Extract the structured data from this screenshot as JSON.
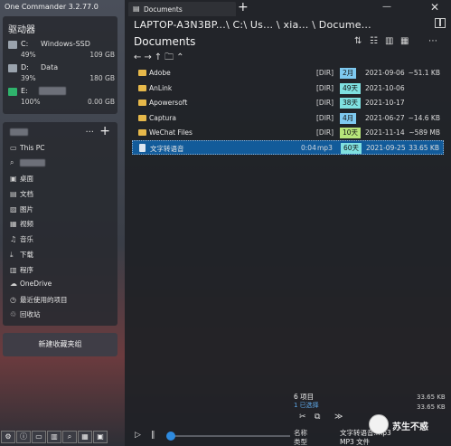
{
  "app": {
    "title": "One Commander 3.2.77.0"
  },
  "drives": {
    "title": "驱动器",
    "items": [
      {
        "letter": "C:",
        "name": "Windows-SSD",
        "percent": "49%",
        "size": "109 GB",
        "color": "#9aa3ad"
      },
      {
        "letter": "D:",
        "name": "Data",
        "percent": "39%",
        "size": "180 GB",
        "color": "#9aa3ad"
      },
      {
        "letter": "E:",
        "name": "",
        "percent": "100%",
        "size": "0.00 GB",
        "color": "#2fb36c"
      }
    ]
  },
  "favorites": {
    "more_label": "···",
    "add_label": "+",
    "items": [
      {
        "icon": "computer-icon",
        "glyph": "▭",
        "label": "This PC"
      },
      {
        "icon": "search-icon",
        "glyph": "⌕",
        "label": ""
      },
      {
        "icon": "desktop-icon",
        "glyph": "▣",
        "label": "桌面"
      },
      {
        "icon": "documents-icon",
        "glyph": "▤",
        "label": "文档"
      },
      {
        "icon": "pictures-icon",
        "glyph": "▨",
        "label": "图片"
      },
      {
        "icon": "videos-icon",
        "glyph": "▦",
        "label": "视频"
      },
      {
        "icon": "music-icon",
        "glyph": "♫",
        "label": "音乐"
      },
      {
        "icon": "downloads-icon",
        "glyph": "⤓",
        "label": "下载"
      },
      {
        "icon": "programs-icon",
        "glyph": "▥",
        "label": "程序"
      },
      {
        "icon": "onedrive-icon",
        "glyph": "☁",
        "label": "OneDrive"
      },
      {
        "icon": "recent-icon",
        "glyph": "◷",
        "label": "最近使用的项目"
      },
      {
        "icon": "recycle-bin-icon",
        "glyph": "♲",
        "label": "回收站"
      }
    ]
  },
  "new_group_label": "新建收藏夹组",
  "tabs": [
    {
      "label": "Documents"
    }
  ],
  "add_tab_label": "+",
  "breadcrumb": "LAPTOP-A3N3BP...\\ C:\\ Us...  \\ xia...  \\ Docume...",
  "pane_title": "Documents",
  "toolbar_glyphs": {
    "sort": "⇅",
    "details": "☷",
    "columns": "▥",
    "tiles": "▦",
    "more": "⋯"
  },
  "nav_glyphs": "←→↑🗀⌃",
  "files": [
    {
      "name": "Adobe",
      "kind": "folder",
      "duration": "",
      "type": "[DIR]",
      "age": "2月",
      "age_color": "#7ec9f0",
      "date": "2021-09-06",
      "size": "~51.1 KB"
    },
    {
      "name": "AnLink",
      "kind": "folder",
      "duration": "",
      "type": "[DIR]",
      "age": "49天",
      "age_color": "#7fe0e0",
      "date": "2021-10-06",
      "size": ""
    },
    {
      "name": "Apowersoft",
      "kind": "folder",
      "duration": "",
      "type": "[DIR]",
      "age": "38天",
      "age_color": "#7fe0e0",
      "date": "2021-10-17",
      "size": ""
    },
    {
      "name": "Captura",
      "kind": "folder",
      "duration": "",
      "type": "[DIR]",
      "age": "4月",
      "age_color": "#7ec9f0",
      "date": "2021-06-27",
      "size": "~14.6 KB"
    },
    {
      "name": "WeChat Files",
      "kind": "folder",
      "duration": "",
      "type": "[DIR]",
      "age": "10天",
      "age_color": "#b7e57a",
      "date": "2021-11-14",
      "size": "~589 MB"
    },
    {
      "name": "文字转语音",
      "kind": "file",
      "duration": "0:04",
      "type": "mp3",
      "age": "60天",
      "age_color": "#7fe0e0",
      "date": "2021-09-25",
      "size": "33.65 KB"
    }
  ],
  "status": {
    "count": "6 项目",
    "selected": "1 已选择",
    "total_size": "33.65 KB",
    "selected_size": "33.65 KB"
  },
  "actions": {
    "cut": "✂",
    "copy": "⧉",
    "more": "≫"
  },
  "player": {
    "play": "▷",
    "pause": "‖",
    "progress": 0.0
  },
  "properties": {
    "name_label": "名称",
    "type_label": "类型",
    "name_value": "文字转语音.mp3",
    "type_value": "MP3 文件"
  },
  "watermark_text": "苏生不惑"
}
